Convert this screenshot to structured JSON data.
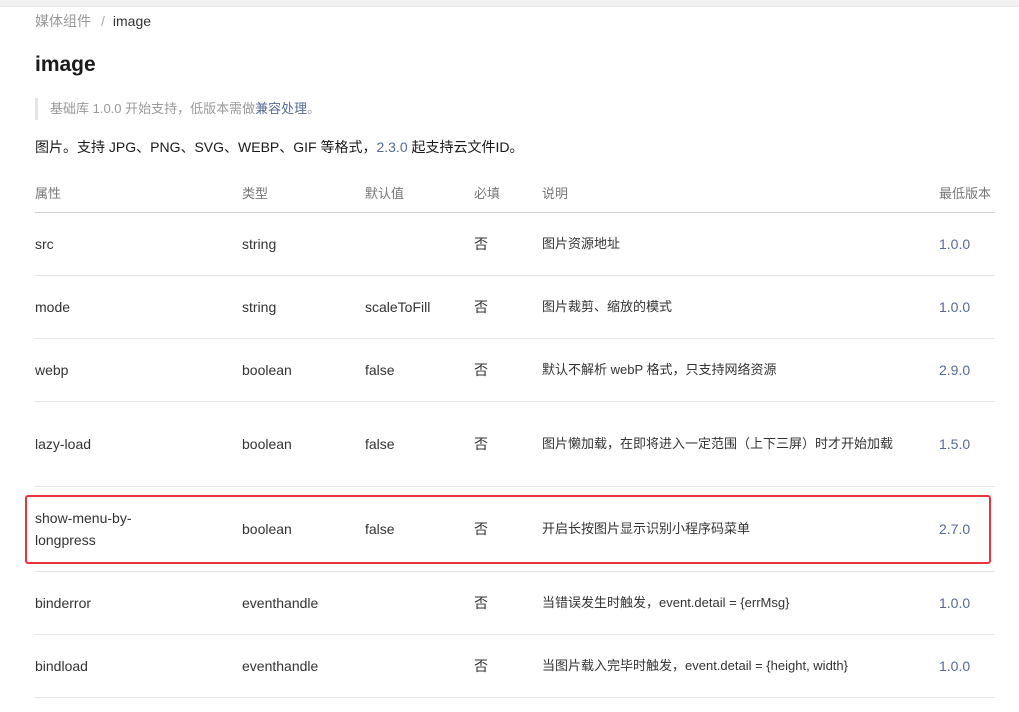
{
  "breadcrumb": {
    "parent": "媒体组件",
    "separator": "/",
    "current": "image"
  },
  "page_title": "image",
  "note": {
    "prefix": "基础库 1.0.0 开始支持，低版本需做",
    "link": "兼容处理",
    "suffix": "。"
  },
  "description": {
    "prefix": "图片。支持 JPG、PNG、SVG、WEBP、GIF 等格式，",
    "version": "2.3.0",
    "suffix": " 起支持云文件ID。"
  },
  "table": {
    "headers": [
      "属性",
      "类型",
      "默认值",
      "必填",
      "说明",
      "最低版本"
    ],
    "rows": [
      {
        "attr": "src",
        "type": "string",
        "default": "",
        "required": "否",
        "desc": "图片资源地址",
        "version": "1.0.0"
      },
      {
        "attr": "mode",
        "type": "string",
        "default": "scaleToFill",
        "required": "否",
        "desc": "图片裁剪、缩放的模式",
        "version": "1.0.0"
      },
      {
        "attr": "webp",
        "type": "boolean",
        "default": "false",
        "required": "否",
        "desc": "默认不解析 webP 格式，只支持网络资源",
        "version": "2.9.0"
      },
      {
        "attr": "lazy-load",
        "type": "boolean",
        "default": "false",
        "required": "否",
        "desc": "图片懒加载，在即将进入一定范围（上下三屏）时才开始加载",
        "version": "1.5.0"
      },
      {
        "attr": "show-menu-by-longpress",
        "type": "boolean",
        "default": "false",
        "required": "否",
        "desc": "开启长按图片显示识别小程序码菜单",
        "version": "2.7.0"
      },
      {
        "attr": "binderror",
        "type": "eventhandle",
        "default": "",
        "required": "否",
        "desc": "当错误发生时触发，event.detail = {errMsg}",
        "version": "1.0.0"
      },
      {
        "attr": "bindload",
        "type": "eventhandle",
        "default": "",
        "required": "否",
        "desc": "当图片载入完毕时触发，event.detail = {height, width}",
        "version": "1.0.0"
      }
    ]
  },
  "colors": {
    "link": "#576b95",
    "highlight": "#e8343a"
  }
}
